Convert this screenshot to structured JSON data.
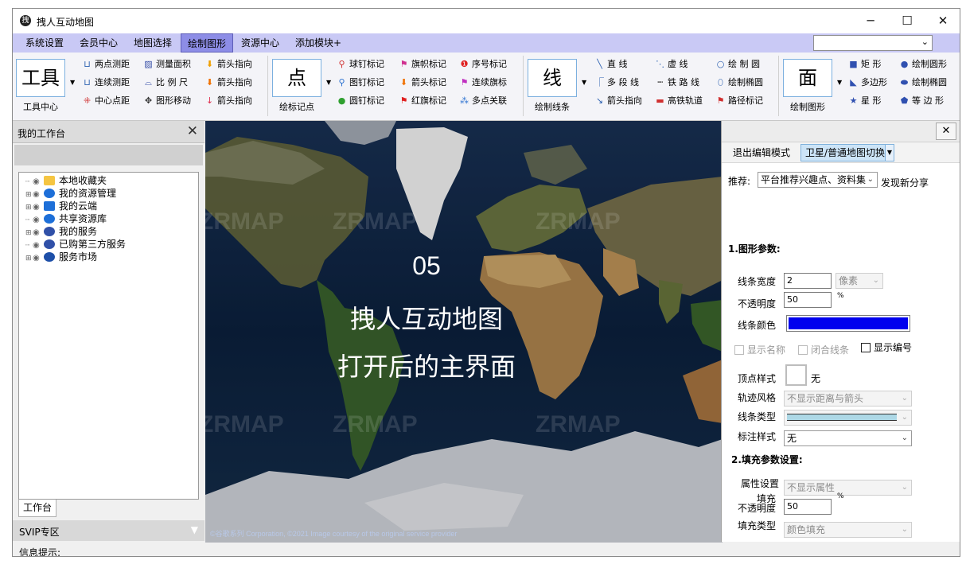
{
  "window": {
    "title": "拽人互动地图",
    "min": "─",
    "max": "☐",
    "close": "✕"
  },
  "menu": {
    "items": [
      "系统设置",
      "会员中心",
      "地图选择",
      "绘制图形",
      "资源中心",
      "添加模块+"
    ],
    "active": "绘制图形"
  },
  "ribbon": {
    "tools": {
      "big": "工具",
      "label": "工具中心",
      "items": [
        "两点测距",
        "测量面积",
        "箭头指向",
        "连续测距",
        "比 例 尺",
        "箭头指向",
        "中心点距",
        "图形移动",
        "箭头指向"
      ]
    },
    "points": {
      "big": "点",
      "label": "绘标记点",
      "items": [
        "球钉标记",
        "旗帜标记",
        "序号标记",
        "图钉标记",
        "箭头标记",
        "连续旗标",
        "圆钉标记",
        "红旗标记",
        "多点关联"
      ]
    },
    "lines": {
      "big": "线",
      "label": "绘制线条",
      "items": [
        "直  线",
        "虚  线",
        "绘 制 圆",
        "多 段 线",
        "铁 路 线",
        "绘制椭圆",
        "箭头指向",
        "高铁轨道",
        "路径标记"
      ]
    },
    "shapes": {
      "big": "面",
      "label": "绘制图形",
      "items": [
        "矩  形",
        "绘制圆形",
        "多边形",
        "绘制椭圆",
        "星  形",
        "等 边 形"
      ]
    }
  },
  "left_panel": {
    "title": "我的工作台",
    "tree": [
      "本地收藏夹",
      "我的资源管理",
      "我的云端",
      "共享资源库",
      "我的服务",
      "已购第三方服务",
      "服务市场"
    ],
    "tab": "工作台",
    "svip": "SVIP专区"
  },
  "status": {
    "text": "信息提示:"
  },
  "map": {
    "overlay_num": "05",
    "overlay_title": "拽人互动地图",
    "overlay_sub": "打开后的主界面",
    "watermark": "ZRMAP",
    "copyright": "©谷歌系列 Corporation, ©2021 Image courtesy of the original service provider"
  },
  "right_panel": {
    "tab_exit": "退出编辑模式",
    "tab_switch": "卫星/普通地图切换",
    "recommend_label": "推荐:",
    "recommend_value": "平台推荐兴趣点、资料集",
    "recommend_link": "发现新分享",
    "section1": "1.图形参数:",
    "line_width_label": "线条宽度",
    "line_width_value": "2",
    "line_width_unit": "像素",
    "opacity_label": "不透明度",
    "opacity_value": "50",
    "percent": "%",
    "line_color_label": "线条颜色",
    "line_color": "#0000ee",
    "show_name": "显示名称",
    "close_line": "闭合线条",
    "show_number": "显示编号",
    "vertex_style_label": "顶点样式",
    "vertex_style_value": "无",
    "track_style_label": "轨迹风格",
    "track_style_value": "不显示距离与箭头",
    "line_type_label": "线条类型",
    "label_style_label": "标注样式",
    "label_style_value": "无",
    "section2": "2.填充参数设置:",
    "attr_label": "属性设置",
    "attr_value": "不显示属性",
    "fill_label_a": "填充",
    "fill_label_b": "不透明度",
    "fill_opacity_value": "50",
    "fill_type_label": "填充类型",
    "fill_type_value": "颜色填充"
  }
}
